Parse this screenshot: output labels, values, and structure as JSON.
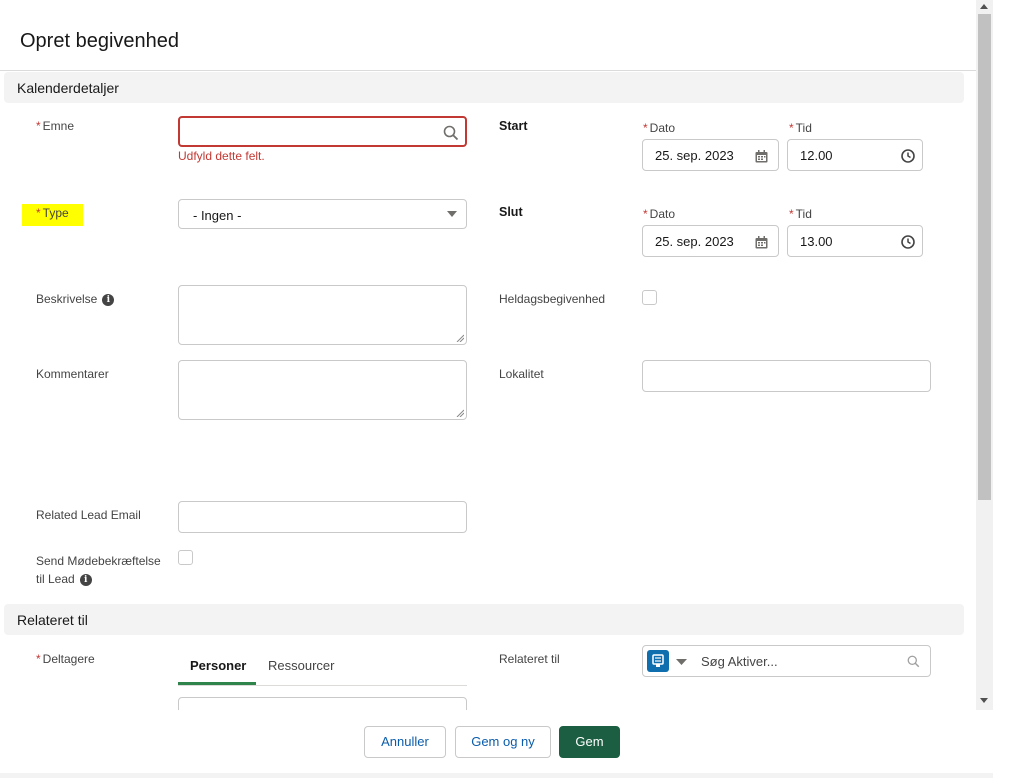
{
  "title": "Opret begivenhed",
  "sections": {
    "calendar": "Kalenderdetaljer",
    "related": "Relateret til"
  },
  "fields": {
    "subject": {
      "required": "*",
      "label": "Emne",
      "value": "",
      "error": "Udfyld dette felt."
    },
    "type": {
      "required": "*",
      "label": "Type",
      "value": "- Ingen -"
    },
    "description": {
      "label": "Beskrivelse"
    },
    "comments": {
      "label": "Kommentarer"
    },
    "lead_email": {
      "label": "Related Lead Email"
    },
    "send_confirmation": {
      "label_line1": "Send Mødebekræftelse",
      "label_line2": "til Lead"
    },
    "start": {
      "label": "Start",
      "date_label": "Dato",
      "date_value": "25. sep. 2023",
      "time_label": "Tid",
      "time_value": "12.00"
    },
    "end": {
      "label": "Slut",
      "date_label": "Dato",
      "date_value": "25. sep. 2023",
      "time_label": "Tid",
      "time_value": "13.00"
    },
    "all_day": {
      "label": "Heldagsbegivenhed"
    },
    "location": {
      "label": "Lokalitet"
    },
    "attendees": {
      "required": "*",
      "label": "Deltagere"
    },
    "related_to": {
      "label": "Relateret til",
      "placeholder": "Søg Aktiver..."
    }
  },
  "tabs": [
    "Personer",
    "Ressourcer"
  ],
  "buttons": {
    "cancel": "Annuller",
    "save_new": "Gem og ny",
    "save": "Gem"
  },
  "colors": {
    "required": "#c23934",
    "brand": "#1b5e41",
    "highlight": "#ffff00"
  }
}
